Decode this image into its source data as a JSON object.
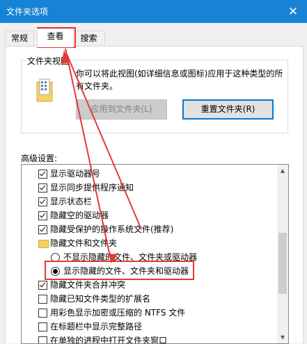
{
  "window": {
    "title": "文件夹选项",
    "close_glyph": "✕"
  },
  "tabs": [
    {
      "label": "常规",
      "active": false
    },
    {
      "label": "查看",
      "active": true
    },
    {
      "label": "搜索",
      "active": false
    }
  ],
  "folder_views": {
    "group_title": "文件夹视图",
    "description": "你可以将此视图(如详细信息或图标)应用于这种类型的所有文件夹。",
    "apply_button": "应用到文件夹(L)",
    "reset_button": "重置文件夹(R)"
  },
  "advanced": {
    "label": "高级设置:",
    "items": [
      {
        "type": "checkbox",
        "checked": true,
        "label": "显示驱动器号"
      },
      {
        "type": "checkbox",
        "checked": true,
        "label": "显示同步提供程序通知"
      },
      {
        "type": "checkbox",
        "checked": true,
        "label": "显示状态栏"
      },
      {
        "type": "checkbox",
        "checked": true,
        "label": "隐藏空的驱动器"
      },
      {
        "type": "checkbox",
        "checked": true,
        "label": "隐藏受保护的操作系统文件(推荐)"
      },
      {
        "type": "folder",
        "label": "隐藏文件和文件夹"
      },
      {
        "type": "radio",
        "checked": false,
        "label": "不显示隐藏的文件、文件夹或驱动器"
      },
      {
        "type": "radio",
        "checked": true,
        "label": "显示隐藏的文件、文件夹和驱动器"
      },
      {
        "type": "checkbox",
        "checked": true,
        "label": "隐藏文件夹合并冲突"
      },
      {
        "type": "checkbox",
        "checked": false,
        "label": "隐藏已知文件类型的扩展名"
      },
      {
        "type": "checkbox",
        "checked": false,
        "label": "用彩色显示加密或压缩的 NTFS 文件"
      },
      {
        "type": "checkbox",
        "checked": false,
        "label": "在标题栏中显示完整路径"
      },
      {
        "type": "checkbox",
        "checked": false,
        "label": "在单独的进程中打开文件夹窗口"
      }
    ]
  },
  "colors": {
    "titlebar": "#1783d6",
    "highlight": "#e53935",
    "accent": "#0078d7"
  }
}
